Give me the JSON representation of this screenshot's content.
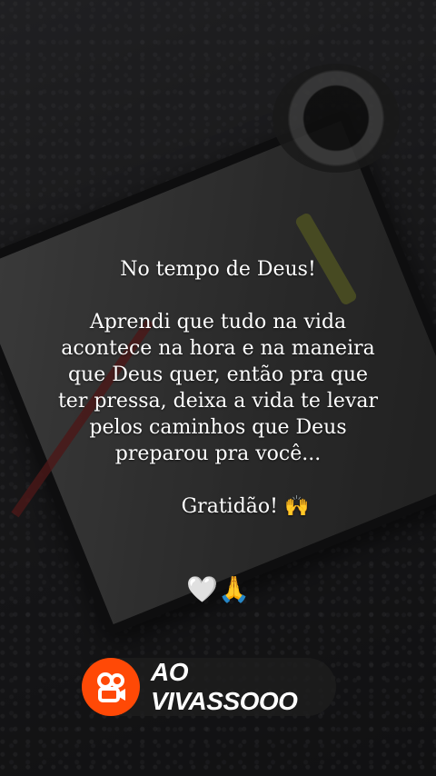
{
  "caption": {
    "title": "No tempo de Deus!",
    "line1": "Aprendi que tudo na vida",
    "line2": "acontece na hora e na maneira",
    "line3": "que Deus quer, então pra que",
    "line4": "ter pressa, deixa a vida te levar",
    "line5": "pelos caminhos que Deus",
    "line6": "preparou pra você...",
    "closing": "Gratidão! 🙌"
  },
  "emojis": "🤍🙏",
  "watermark": {
    "app_icon": "kwai-logo-icon",
    "username": "AO VIVASSOOO",
    "brand_color": "#ff4906"
  }
}
